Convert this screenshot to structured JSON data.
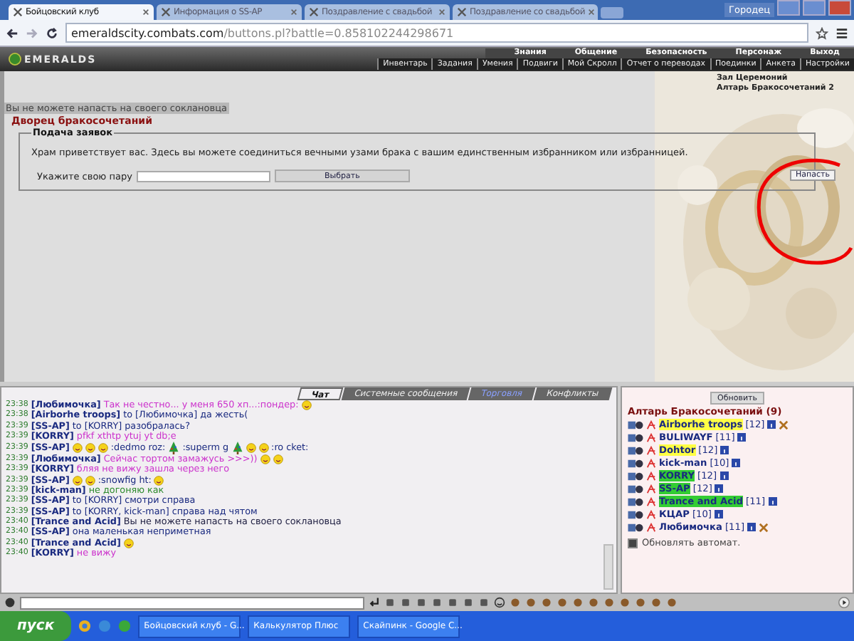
{
  "browser": {
    "tabs": [
      {
        "title": "Бойцовский клуб",
        "selected": true
      },
      {
        "title": "Информация о SS-AP",
        "selected": false
      },
      {
        "title": "Поздравление с свадьбой",
        "selected": false
      },
      {
        "title": "Поздравление со свадьбой",
        "selected": false
      }
    ],
    "user": "Городец",
    "address_host": "emeraldscity.combats.com",
    "address_path": "/buttons.pl?battle=0.858102244298671"
  },
  "game": {
    "logo": "EMERALDS",
    "top_menu": [
      "Знания",
      "Общение",
      "Безопасность",
      "Персонаж",
      "Выход"
    ],
    "sub_menu": [
      "Инвентарь",
      "Задания",
      "Умения",
      "Подвиги",
      "Мой Скролл",
      "Отчет о переводах",
      "Поединки",
      "Анкета",
      "Настройки"
    ]
  },
  "main": {
    "notice": "Вы не можете напасть на своего соклановца",
    "title": "Дворец бракосочетаний",
    "legend": "Подача заявок",
    "welcome": "Храм приветствует вас. Здесь вы можете соединиться вечными узами брака с вашим единственным избранником или избранницей.",
    "pair_label": "Укажите свою пару",
    "choose_button": "Выбрать",
    "links": [
      "Зал Церемоний",
      "Алтарь Бракосочетаний 2"
    ],
    "attack_button": "Напасть"
  },
  "chat": {
    "tabs": [
      {
        "label": "Чат",
        "selected": true,
        "highlighted": false
      },
      {
        "label": "Системные сообщения",
        "selected": false,
        "highlighted": false
      },
      {
        "label": "Торговля",
        "selected": false,
        "highlighted": true
      },
      {
        "label": "Конфликты",
        "selected": false,
        "highlighted": false
      }
    ],
    "messages": [
      {
        "time": "23:38",
        "from": "[Любимочка]",
        "color": "#cc33cc",
        "parts": [
          {
            "kind": "text",
            "text": "Так не честно... у меня 650 хп...:пондер:"
          },
          {
            "kind": "smiley"
          }
        ]
      },
      {
        "time": "23:38",
        "from": "[Airborhe troops]",
        "to": "to [Любимочка]",
        "color": "#1a2a80",
        "parts": [
          {
            "kind": "text",
            "text": "да жесть("
          }
        ]
      },
      {
        "time": "23:39",
        "from": "[SS-AP]",
        "to": "to [KORRY]",
        "color": "#1a2a80",
        "parts": [
          {
            "kind": "text",
            "text": "разобралась?"
          }
        ]
      },
      {
        "time": "23:39",
        "from": "[KORRY]",
        "color": "#cc33cc",
        "parts": [
          {
            "kind": "text",
            "text": "pfkf xthtp ytuj yt db;e"
          }
        ]
      },
      {
        "time": "23:39",
        "from": "[SS-AP]",
        "color": "#1a2a80",
        "parts": [
          {
            "kind": "smiley"
          },
          {
            "kind": "smiley"
          },
          {
            "kind": "smiley"
          },
          {
            "kind": "text",
            "text": ":dedmo roz:"
          },
          {
            "kind": "tree"
          },
          {
            "kind": "text",
            "text": ":superm g"
          },
          {
            "kind": "tree"
          },
          {
            "kind": "smiley"
          },
          {
            "kind": "smiley"
          },
          {
            "kind": "text",
            "text": ":ro cket:"
          }
        ]
      },
      {
        "time": "23:39",
        "from": "[Любимочка]",
        "color": "#cc33cc",
        "parts": [
          {
            "kind": "text",
            "text": "Сейчас тортом замажусь >>>))"
          },
          {
            "kind": "smiley"
          },
          {
            "kind": "smiley"
          }
        ]
      },
      {
        "time": "23:39",
        "from": "[KORRY]",
        "color": "#cc33cc",
        "parts": [
          {
            "kind": "text",
            "text": "бляя не вижу зашла через него"
          }
        ]
      },
      {
        "time": "23:39",
        "from": "[SS-AP]",
        "color": "#1a2a80",
        "parts": [
          {
            "kind": "smiley"
          },
          {
            "kind": "smiley"
          },
          {
            "kind": "text",
            "text": ":snowfig ht:"
          },
          {
            "kind": "smiley"
          }
        ]
      },
      {
        "time": "23:39",
        "from": "[kick-man]",
        "color": "#2e8b2e",
        "parts": [
          {
            "kind": "text",
            "text": "не догоняю как"
          }
        ]
      },
      {
        "time": "23:39",
        "from": "[SS-AP]",
        "to": "to [KORRY]",
        "color": "#1a2a80",
        "parts": [
          {
            "kind": "text",
            "text": "смотри справа"
          }
        ]
      },
      {
        "time": "23:39",
        "from": "[SS-AP]",
        "to": "to [KORRY, kick-man]",
        "color": "#1a2a80",
        "parts": [
          {
            "kind": "text",
            "text": "справа над чятом"
          }
        ]
      },
      {
        "time": "23:40",
        "from": "[Trance and Acid]",
        "color": "#222244",
        "parts": [
          {
            "kind": "text",
            "text": "Вы не можете напасть на своего соклановца"
          }
        ]
      },
      {
        "time": "23:40",
        "from": "[SS-AP]",
        "color": "#1a2a80",
        "parts": [
          {
            "kind": "text",
            "text": "она маленькая неприметная"
          }
        ]
      },
      {
        "time": "23:40",
        "from": "[Trance and Acid]",
        "parts": [
          {
            "kind": "smiley"
          }
        ]
      },
      {
        "time": "23:40",
        "from": "[KORRY]",
        "color": "#cc33cc",
        "parts": [
          {
            "kind": "text",
            "text": "не вижу"
          }
        ]
      }
    ]
  },
  "room": {
    "refresh_button": "Обновить",
    "title": "Алтарь Бракосочетаний (9)",
    "users": [
      {
        "name": "Airborhe troops",
        "level": "[12]",
        "color": "#ffff44",
        "marked": true
      },
      {
        "name": "BULIWAYF",
        "level": "[11]",
        "marked": false
      },
      {
        "name": "Dohtor",
        "level": "[12]",
        "color": "#ffff44",
        "marked": false
      },
      {
        "name": "kick-man",
        "level": "[10]",
        "marked": false
      },
      {
        "name": "KORRY",
        "level": "[12]",
        "color": "#33cc33",
        "marked": false
      },
      {
        "name": "SS-AP",
        "level": "[12]",
        "color": "#33cc33",
        "marked": false
      },
      {
        "name": "Trance and Acid",
        "level": "[11]",
        "color": "#33cc33",
        "marked": false
      },
      {
        "name": "КЦАР",
        "level": "[10]",
        "marked": false
      },
      {
        "name": "Любимочка",
        "level": "[11]",
        "marked": true
      }
    ],
    "auto_refresh": {
      "label": "Обновлять автомат.",
      "checked": true
    }
  },
  "taskbar": {
    "start": "пуск",
    "tasks": [
      "Бойцовский клуб - G...",
      "Калькулятор Плюс",
      "Скайпинк - Google C..."
    ]
  }
}
